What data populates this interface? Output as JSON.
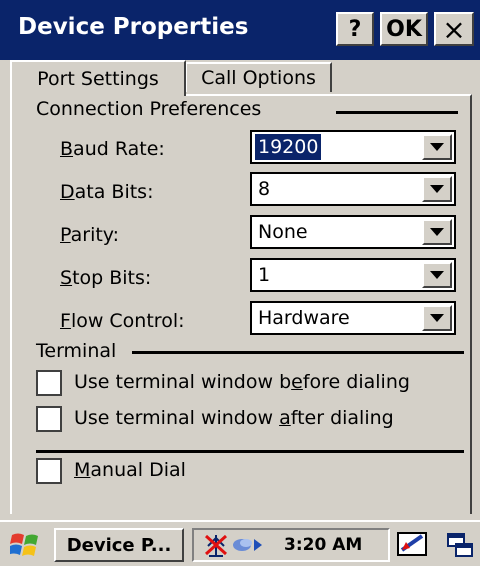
{
  "window": {
    "title": "Device Properties",
    "help_label": "?",
    "ok_label": "OK",
    "close_label": "×"
  },
  "tabs": [
    {
      "label": "Port Settings",
      "active": true
    },
    {
      "label": "Call Options",
      "active": false
    }
  ],
  "connection_preferences": {
    "heading": "Connection Preferences",
    "fields": [
      {
        "label_accel": "B",
        "label_rest": "aud Rate:",
        "value": "19200",
        "selected": true
      },
      {
        "label_accel": "D",
        "label_rest": "ata Bits:",
        "value": "8"
      },
      {
        "label_accel": "P",
        "label_rest": "arity:",
        "value": "None"
      },
      {
        "label_accel": "S",
        "label_rest": "top Bits:",
        "value": "1"
      },
      {
        "label_accel": "F",
        "label_rest": "low Control:",
        "value": "Hardware"
      }
    ]
  },
  "terminal": {
    "heading": "Terminal",
    "before": {
      "pre": "Use terminal window b",
      "accel": "e",
      "post": "fore dialing",
      "checked": false
    },
    "after": {
      "pre": "Use terminal window ",
      "accel": "a",
      "post": "fter dialing",
      "checked": false
    }
  },
  "manual_dial": {
    "accel": "M",
    "rest": "anual Dial",
    "checked": false
  },
  "taskbar": {
    "task_label": "Device P...",
    "clock": "3:20 AM"
  },
  "colors": {
    "titlebar": "#0a246a",
    "face": "#d4d0c8",
    "selection": "#0a246a"
  }
}
